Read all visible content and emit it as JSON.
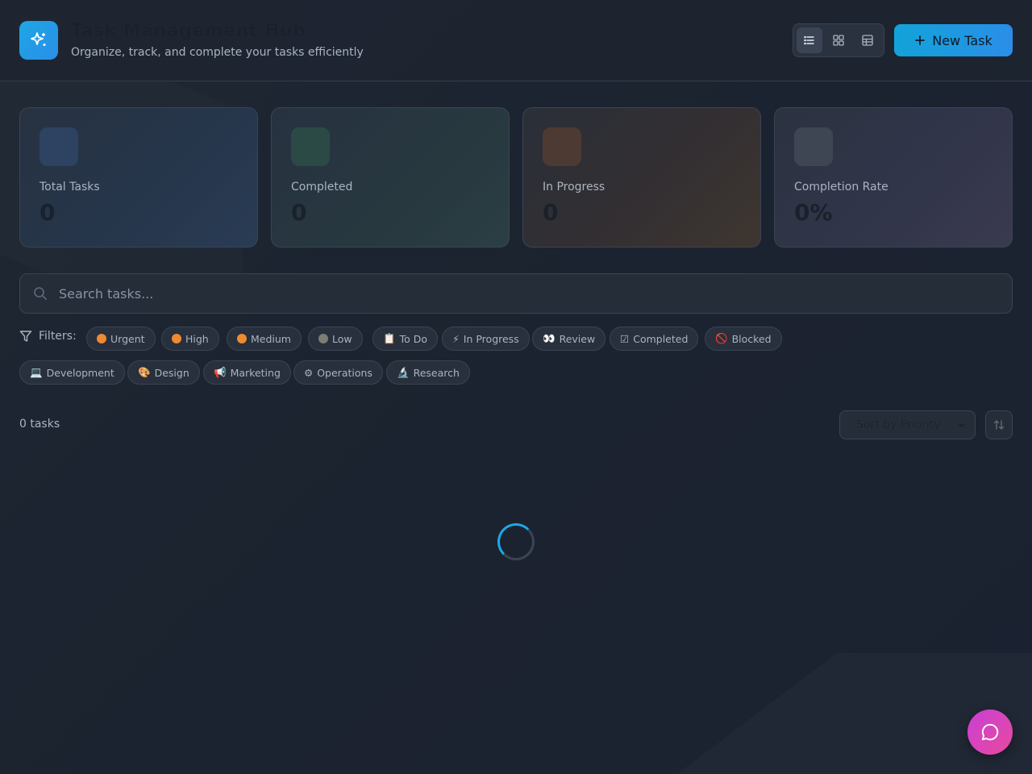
{
  "header": {
    "title": "Task Management Hub",
    "subtitle": "Organize, track, and complete your tasks efficiently",
    "new_task_label": "New Task",
    "logo_icon": "sparkles-icon",
    "views": [
      "list-icon",
      "grid-icon",
      "table-icon"
    ]
  },
  "stats": [
    {
      "label": "Total Tasks",
      "value": "0",
      "tint": "#2b4a70"
    },
    {
      "label": "Completed",
      "value": "0",
      "tint": "#2b5148"
    },
    {
      "label": "In Progress",
      "value": "0",
      "tint": "#5a4236"
    },
    {
      "label": "Completion Rate",
      "value": "0%",
      "tint": "#403f58"
    }
  ],
  "search": {
    "placeholder": "Search tasks..."
  },
  "filters": {
    "label": "Filters:",
    "priority": [
      {
        "label": "Urgent",
        "color": "#f08a30"
      },
      {
        "label": "High",
        "color": "#f08a30"
      },
      {
        "label": "Medium",
        "color": "#f08a30"
      },
      {
        "label": "Low",
        "color": "#7a7f73"
      }
    ],
    "status": [
      {
        "label": "To Do",
        "emoji": "📋"
      },
      {
        "label": "In Progress",
        "emoji": "⚡"
      },
      {
        "label": "Review",
        "emoji": "👀"
      },
      {
        "label": "Completed",
        "emoji": "☑"
      },
      {
        "label": "Blocked",
        "emoji": "🚫"
      }
    ],
    "category": [
      {
        "label": "Development",
        "emoji": "💻"
      },
      {
        "label": "Design",
        "emoji": "🎨"
      },
      {
        "label": "Marketing",
        "emoji": "📢"
      },
      {
        "label": "Operations",
        "emoji": "⚙"
      },
      {
        "label": "Research",
        "emoji": "🔬"
      }
    ]
  },
  "tasks": {
    "count_label": "0 tasks",
    "sort_label": "Sort by Priority"
  },
  "colors": {
    "accent": "#1ea7e4",
    "chat_gradient_start": "#c93fd6",
    "chat_gradient_end": "#e84a9e"
  }
}
